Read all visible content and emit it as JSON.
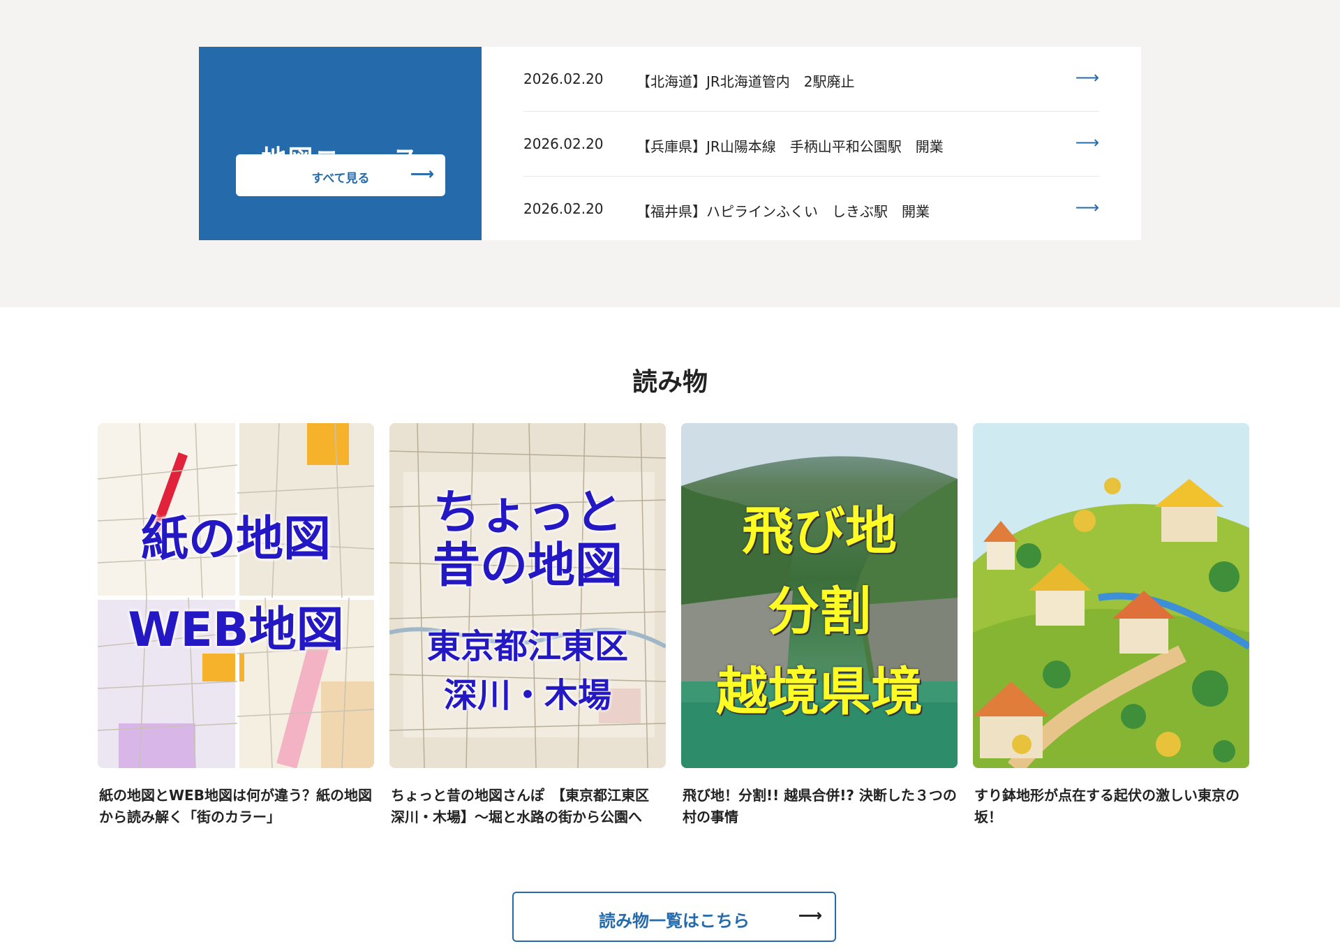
{
  "news": {
    "title": "地図ニュース",
    "see_all_label": "すべて見る",
    "items": [
      {
        "date": "2026.02.20",
        "text": "【北海道】JR北海道管内　2駅廃止"
      },
      {
        "date": "2026.02.20",
        "text": "【兵庫県】JR山陽本線　手柄山平和公園駅　開業"
      },
      {
        "date": "2026.02.20",
        "text": "【福井県】ハピラインふくい　しきぶ駅　開業"
      }
    ]
  },
  "reading": {
    "title": "読み物",
    "cards": [
      {
        "caption": "紙の地図とWEB地図は何が違う？紙の地図から読み解く「街のカラー」",
        "thumb_lines": [
          "紙の地図",
          "WEB地図"
        ]
      },
      {
        "caption": "ちょっと昔の地図さんぽ　【東京都江東区 深川・木場】～堀と水路の街から公園へ",
        "thumb_lines": [
          "ちょっと",
          "昔の地図",
          "東京都江東区",
          "深川・木場"
        ]
      },
      {
        "caption": "飛び地！分割!! 越県合併!? 決断した３つの村の事情",
        "thumb_lines": [
          "飛び地",
          "分割",
          "越境県境"
        ]
      },
      {
        "caption": "すり鉢地形が点在する起伏の激しい東京の坂！",
        "thumb_lines": []
      }
    ],
    "more_label": "読み物一覧はこちら"
  },
  "icons": {
    "arrow": "arrow-right-icon"
  },
  "colors": {
    "brand_blue": "#256bac",
    "thumb_text_blue": "#2418c4",
    "thumb_text_yellow": "#fffb24"
  }
}
